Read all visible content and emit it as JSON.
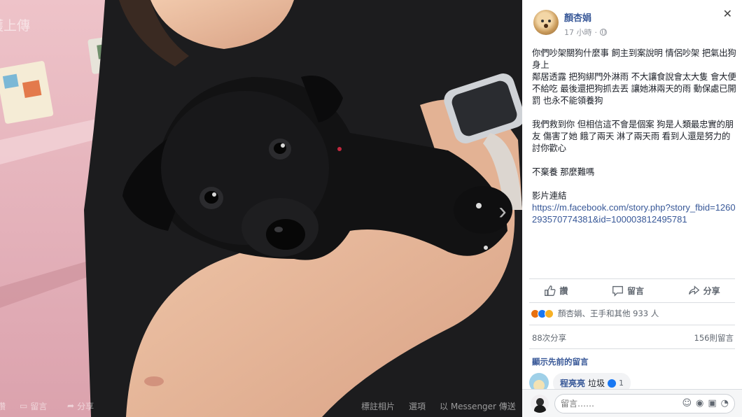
{
  "photo": {
    "watermark": "護上傳",
    "next_glyph": "›",
    "bar": {
      "like_label": "讚",
      "comment_label": "留言",
      "share_label": "分享",
      "tag_label": "標註相片",
      "options_label": "選項",
      "messenger_label": "以 Messenger 傳送"
    }
  },
  "post": {
    "author": "顏杏娟",
    "time": "17 小時",
    "paragraphs": [
      "你們吵架關狗什麼事 飼主到案說明 情侶吵架 把氣出狗身上",
      "鄰居透露 把狗綁門外淋雨 不大讓食說會太大隻 會大便不給吃 最後還把狗抓去丟 讓她淋兩天的雨 動保處已開罰 也永不能領養狗",
      "我們救到你 但相信這不會是個案 狗是人類最忠實的朋友 傷害了她 餓了兩天 淋了兩天雨 看到人還是努力的討你歡心",
      "不棄養 那麼難嗎"
    ],
    "video_label": "影片連結",
    "link": "https://m.facebook.com/story.php?story_fbid=1260293570774381&id=100003812495781"
  },
  "actions": {
    "like": "讚",
    "comment": "留言",
    "share": "分享"
  },
  "reactions": {
    "text": "顏杏娟、王手和其他 933 人"
  },
  "stats": {
    "shares": "88次分享",
    "comments": "156則留言"
  },
  "prev_comments": "顯示先前的留言",
  "comment": {
    "author": "程亮亮",
    "text": "垃圾",
    "likes": "1"
  },
  "composer": {
    "placeholder": "留言……"
  },
  "colors": {
    "link": "#385898",
    "text": "#1d2129",
    "meta": "#90949c",
    "photo_bg": "#e8b7bf"
  }
}
